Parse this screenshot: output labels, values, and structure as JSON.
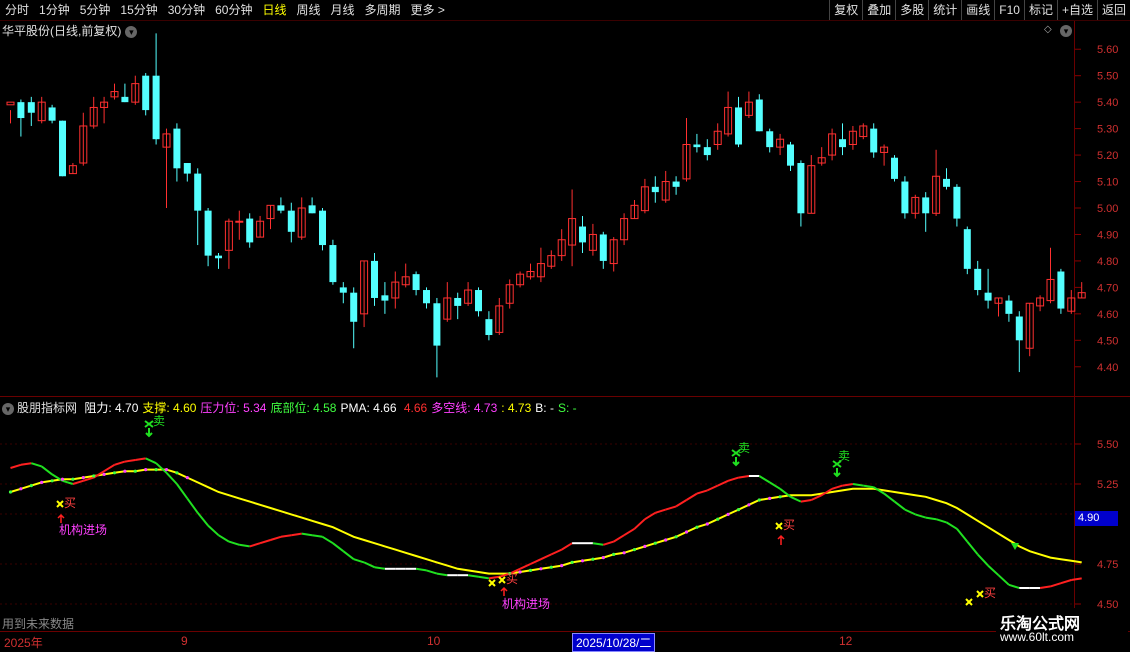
{
  "toolbar": {
    "periods": [
      "分时",
      "1分钟",
      "5分钟",
      "15分钟",
      "30分钟",
      "60分钟",
      "日线",
      "周线",
      "月线",
      "多周期",
      "更多 >"
    ],
    "active_period": "日线",
    "right_buttons": [
      "复权",
      "叠加",
      "多股",
      "统计",
      "画线",
      "F10",
      "标记",
      "+自选",
      "返回"
    ]
  },
  "main_panel": {
    "title": "华平股份(日线,前复权)",
    "y_ticks": [
      "5.60",
      "5.50",
      "5.40",
      "5.30",
      "5.20",
      "5.10",
      "5.00",
      "4.90",
      "4.80",
      "4.70",
      "4.60",
      "4.50",
      "4.40"
    ]
  },
  "indicator": {
    "name": "股朋指标网",
    "fields": [
      {
        "label": "阻力:",
        "value": "4.70",
        "color": "#ffffff"
      },
      {
        "label": "支撑:",
        "value": "4.60",
        "color": "#ffff00"
      },
      {
        "label": "压力位:",
        "value": "5.34",
        "color": "#ff40ff"
      },
      {
        "label": "底部位:",
        "value": "4.58",
        "color": "#40ff40"
      },
      {
        "label": "PMA:",
        "value": "4.66",
        "color": "#ffffff"
      },
      {
        "label": "",
        "value": "4.66",
        "color": "#ff3030"
      },
      {
        "label": "多空线:",
        "value": "4.73",
        "color": "#ff40ff"
      },
      {
        "label": ":",
        "value": "4.73",
        "color": "#ffff00"
      },
      {
        "label": "B:",
        "value": "-",
        "color": "#ffffff"
      },
      {
        "label": "S:",
        "value": "-",
        "color": "#40ff40"
      }
    ],
    "y_ticks": [
      "5.50",
      "5.25",
      "4.75",
      "4.50"
    ],
    "current_price": "4.90",
    "annotations": [
      "机构进场",
      "机构进场"
    ],
    "sell_label": "卖",
    "buy_label": "买"
  },
  "bottom": {
    "dates": [
      "2025年",
      "9",
      "10",
      "11",
      "12"
    ],
    "selected_date": "2025/10/28/二",
    "footnote": "用到未来数据"
  },
  "watermark": {
    "line1": "乐淘公式网",
    "line2": "www.60lt.com"
  },
  "chart_data": [
    {
      "type": "candlestick",
      "title": "华平股份(日线,前复权)",
      "ylim": [
        4.35,
        5.65
      ],
      "up_color": "#ff3030",
      "down_color": "#54ffff",
      "candles": [
        [
          5.39,
          5.4,
          5.37,
          5.32
        ],
        [
          5.4,
          5.34,
          5.41,
          5.27
        ],
        [
          5.4,
          5.36,
          5.42,
          5.31
        ],
        [
          5.33,
          5.4,
          5.42,
          5.32
        ],
        [
          5.38,
          5.33,
          5.39,
          5.32
        ],
        [
          5.33,
          5.12,
          5.33,
          5.12
        ],
        [
          5.13,
          5.16,
          5.17,
          5.13
        ],
        [
          5.17,
          5.31,
          5.36,
          5.16
        ],
        [
          5.31,
          5.38,
          5.42,
          5.3
        ],
        [
          5.38,
          5.4,
          5.42,
          5.32
        ],
        [
          5.42,
          5.44,
          5.47,
          5.41
        ],
        [
          5.42,
          5.4,
          5.47,
          5.4
        ],
        [
          5.4,
          5.47,
          5.5,
          5.39
        ],
        [
          5.5,
          5.37,
          5.51,
          5.35
        ],
        [
          5.5,
          5.26,
          5.66,
          5.24
        ],
        [
          5.23,
          5.28,
          5.3,
          5.0
        ],
        [
          5.3,
          5.15,
          5.32,
          5.1
        ],
        [
          5.17,
          5.13,
          5.17,
          5.1
        ],
        [
          5.13,
          4.99,
          5.15,
          4.86
        ],
        [
          4.99,
          4.82,
          5.0,
          4.78
        ],
        [
          4.82,
          4.81,
          4.83,
          4.77
        ],
        [
          4.84,
          4.95,
          4.96,
          4.77
        ],
        [
          4.95,
          4.95,
          4.99,
          4.88
        ],
        [
          4.96,
          4.87,
          4.98,
          4.85
        ],
        [
          4.89,
          4.95,
          4.97,
          4.89
        ],
        [
          4.96,
          5.01,
          5.01,
          4.92
        ],
        [
          5.01,
          4.99,
          5.04,
          4.98
        ],
        [
          4.99,
          4.91,
          5.02,
          4.87
        ],
        [
          4.89,
          5.0,
          5.04,
          4.88
        ],
        [
          5.01,
          4.98,
          5.04,
          4.98
        ],
        [
          4.99,
          4.86,
          5.0,
          4.84
        ],
        [
          4.86,
          4.72,
          4.88,
          4.71
        ],
        [
          4.7,
          4.68,
          4.72,
          4.64
        ],
        [
          4.68,
          4.57,
          4.7,
          4.47
        ],
        [
          4.6,
          4.8,
          4.8,
          4.55
        ],
        [
          4.8,
          4.66,
          4.83,
          4.63
        ],
        [
          4.67,
          4.65,
          4.72,
          4.6
        ],
        [
          4.66,
          4.72,
          4.76,
          4.62
        ],
        [
          4.71,
          4.74,
          4.79,
          4.7
        ],
        [
          4.75,
          4.69,
          4.76,
          4.67
        ],
        [
          4.69,
          4.64,
          4.7,
          4.62
        ],
        [
          4.64,
          4.48,
          4.66,
          4.36
        ],
        [
          4.58,
          4.66,
          4.72,
          4.57
        ],
        [
          4.66,
          4.63,
          4.68,
          4.58
        ],
        [
          4.64,
          4.69,
          4.72,
          4.63
        ],
        [
          4.69,
          4.61,
          4.7,
          4.59
        ],
        [
          4.58,
          4.52,
          4.61,
          4.5
        ],
        [
          4.53,
          4.63,
          4.66,
          4.52
        ],
        [
          4.64,
          4.71,
          4.73,
          4.62
        ],
        [
          4.71,
          4.75,
          4.76,
          4.7
        ],
        [
          4.74,
          4.76,
          4.79,
          4.73
        ],
        [
          4.74,
          4.79,
          4.85,
          4.72
        ],
        [
          4.78,
          4.82,
          4.84,
          4.77
        ],
        [
          4.82,
          4.88,
          4.92,
          4.8
        ],
        [
          4.86,
          4.96,
          5.07,
          4.78
        ],
        [
          4.93,
          4.87,
          4.97,
          4.83
        ],
        [
          4.84,
          4.9,
          4.94,
          4.82
        ],
        [
          4.9,
          4.8,
          4.91,
          4.77
        ],
        [
          4.79,
          4.88,
          4.89,
          4.76
        ],
        [
          4.88,
          4.96,
          4.98,
          4.86
        ],
        [
          4.96,
          5.01,
          5.03,
          4.96
        ],
        [
          4.99,
          5.08,
          5.11,
          4.98
        ],
        [
          5.08,
          5.06,
          5.12,
          5.02
        ],
        [
          5.03,
          5.1,
          5.14,
          5.02
        ],
        [
          5.1,
          5.08,
          5.12,
          5.05
        ],
        [
          5.11,
          5.24,
          5.34,
          5.1
        ],
        [
          5.24,
          5.23,
          5.28,
          5.21
        ],
        [
          5.23,
          5.2,
          5.26,
          5.18
        ],
        [
          5.24,
          5.29,
          5.32,
          5.22
        ],
        [
          5.28,
          5.38,
          5.44,
          5.27
        ],
        [
          5.38,
          5.24,
          5.42,
          5.23
        ],
        [
          5.35,
          5.4,
          5.44,
          5.34
        ],
        [
          5.41,
          5.29,
          5.43,
          5.29
        ],
        [
          5.29,
          5.23,
          5.3,
          5.21
        ],
        [
          5.23,
          5.26,
          5.28,
          5.2
        ],
        [
          5.24,
          5.16,
          5.25,
          5.14
        ],
        [
          5.17,
          4.98,
          5.18,
          4.93
        ],
        [
          4.98,
          5.16,
          5.2,
          4.98
        ],
        [
          5.17,
          5.19,
          5.23,
          5.16
        ],
        [
          5.2,
          5.28,
          5.3,
          5.18
        ],
        [
          5.26,
          5.23,
          5.32,
          5.2
        ],
        [
          5.24,
          5.29,
          5.31,
          5.22
        ],
        [
          5.27,
          5.31,
          5.32,
          5.26
        ],
        [
          5.3,
          5.21,
          5.32,
          5.19
        ],
        [
          5.21,
          5.23,
          5.24,
          5.16
        ],
        [
          5.19,
          5.11,
          5.2,
          5.1
        ],
        [
          5.1,
          4.98,
          5.12,
          4.96
        ],
        [
          4.98,
          5.04,
          5.05,
          4.96
        ],
        [
          5.04,
          4.98,
          5.06,
          4.91
        ],
        [
          4.98,
          5.12,
          5.22,
          4.97
        ],
        [
          5.11,
          5.08,
          5.15,
          5.07
        ],
        [
          5.08,
          4.96,
          5.09,
          4.93
        ],
        [
          4.92,
          4.77,
          4.93,
          4.75
        ],
        [
          4.77,
          4.69,
          4.8,
          4.67
        ],
        [
          4.68,
          4.65,
          4.77,
          4.62
        ],
        [
          4.64,
          4.66,
          4.66,
          4.59
        ],
        [
          4.65,
          4.6,
          4.67,
          4.57
        ],
        [
          4.59,
          4.5,
          4.61,
          4.38
        ],
        [
          4.47,
          4.64,
          4.64,
          4.44
        ],
        [
          4.63,
          4.66,
          4.67,
          4.61
        ],
        [
          4.65,
          4.73,
          4.85,
          4.64
        ],
        [
          4.76,
          4.62,
          4.77,
          4.6
        ],
        [
          4.61,
          4.66,
          4.69,
          4.6
        ],
        [
          4.66,
          4.68,
          4.72,
          4.66
        ]
      ]
    },
    {
      "type": "line",
      "title": "股朋指标网",
      "ylim": [
        4.4,
        5.7
      ],
      "series": [
        {
          "name": "多空线",
          "color": "#ffff00",
          "values": [
            5.2,
            5.22,
            5.24,
            5.26,
            5.27,
            5.28,
            5.28,
            5.29,
            5.3,
            5.31,
            5.32,
            5.33,
            5.33,
            5.34,
            5.34,
            5.34,
            5.32,
            5.29,
            5.26,
            5.23,
            5.2,
            5.18,
            5.16,
            5.14,
            5.12,
            5.1,
            5.08,
            5.06,
            5.04,
            5.02,
            5.0,
            4.98,
            4.95,
            4.92,
            4.9,
            4.88,
            4.86,
            4.84,
            4.82,
            4.8,
            4.78,
            4.76,
            4.74,
            4.72,
            4.71,
            4.7,
            4.69,
            4.69,
            4.69,
            4.7,
            4.71,
            4.72,
            4.73,
            4.74,
            4.76,
            4.77,
            4.78,
            4.79,
            4.81,
            4.82,
            4.84,
            4.86,
            4.88,
            4.9,
            4.92,
            4.95,
            4.98,
            5.0,
            5.03,
            5.06,
            5.09,
            5.12,
            5.15,
            5.16,
            5.17,
            5.18,
            5.18,
            5.18,
            5.19,
            5.2,
            5.21,
            5.22,
            5.22,
            5.22,
            5.21,
            5.2,
            5.19,
            5.18,
            5.17,
            5.15,
            5.13,
            5.1,
            5.06,
            5.02,
            4.98,
            4.94,
            4.9,
            4.86,
            4.83,
            4.81,
            4.79,
            4.78,
            4.77,
            4.76
          ]
        },
        {
          "name": "PMA",
          "color": "#ff3030",
          "values": [
            5.35,
            5.37,
            5.38,
            5.36,
            5.31,
            5.27,
            5.25,
            5.27,
            5.29,
            5.33,
            5.37,
            5.39,
            5.4,
            5.41,
            5.38,
            5.32,
            5.25,
            5.16,
            5.07,
            4.99,
            4.93,
            4.89,
            4.87,
            4.86,
            4.88,
            4.9,
            4.92,
            4.93,
            4.94,
            4.93,
            4.92,
            4.88,
            4.83,
            4.78,
            4.76,
            4.73,
            4.72,
            4.72,
            4.72,
            4.72,
            4.71,
            4.69,
            4.68,
            4.68,
            4.68,
            4.67,
            4.66,
            4.67,
            4.69,
            4.72,
            4.75,
            4.78,
            4.81,
            4.84,
            4.88,
            4.88,
            4.88,
            4.87,
            4.89,
            4.93,
            4.97,
            5.03,
            5.07,
            5.09,
            5.11,
            5.15,
            5.19,
            5.21,
            5.24,
            5.27,
            5.29,
            5.3,
            5.3,
            5.26,
            5.22,
            5.17,
            5.14,
            5.15,
            5.18,
            5.22,
            5.24,
            5.25,
            5.24,
            5.23,
            5.19,
            5.14,
            5.09,
            5.06,
            5.04,
            5.03,
            5.01,
            4.97,
            4.89,
            4.81,
            4.74,
            4.68,
            4.62,
            4.6,
            4.6,
            4.6,
            4.61,
            4.63,
            4.65,
            4.66
          ]
        }
      ]
    }
  ]
}
